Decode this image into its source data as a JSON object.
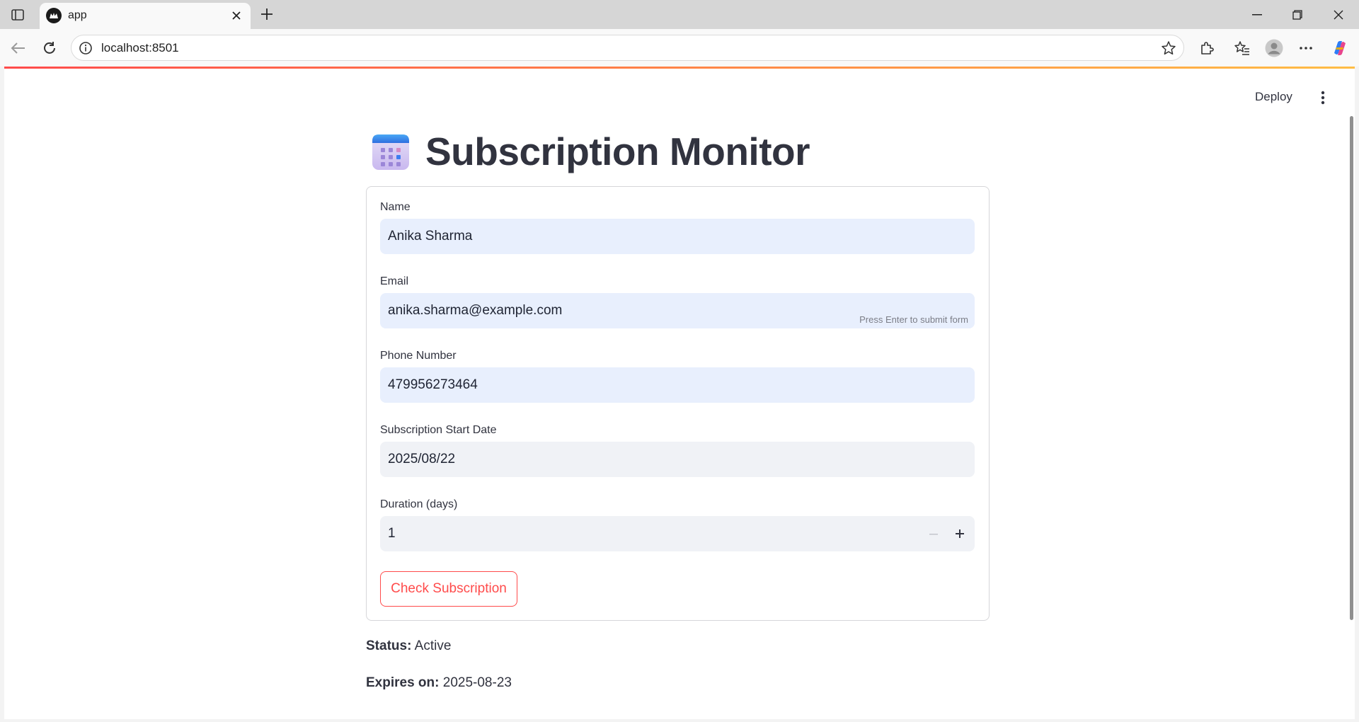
{
  "browser": {
    "tab_title": "app",
    "url": "localhost:8501"
  },
  "header": {
    "deploy_label": "Deploy"
  },
  "page": {
    "title": "Subscription Monitor",
    "title_icon": "calendar-icon"
  },
  "form": {
    "name": {
      "label": "Name",
      "value": "Anika Sharma"
    },
    "email": {
      "label": "Email",
      "value": "anika.sharma@example.com",
      "hint": "Press Enter to submit form"
    },
    "phone": {
      "label": "Phone Number",
      "value": "479956273464"
    },
    "start_date": {
      "label": "Subscription Start Date",
      "value": "2025/08/22"
    },
    "duration": {
      "label": "Duration (days)",
      "value": "1"
    },
    "submit_label": "Check Subscription"
  },
  "result": {
    "status_label": "Status:",
    "status_value": "Active",
    "expires_label": "Expires on:",
    "expires_value": "2025-08-23"
  },
  "colors": {
    "accent": "#ff4b4b",
    "input_focus_bg": "#e8effd",
    "input_bg": "#f0f2f6",
    "text": "#31333f"
  }
}
